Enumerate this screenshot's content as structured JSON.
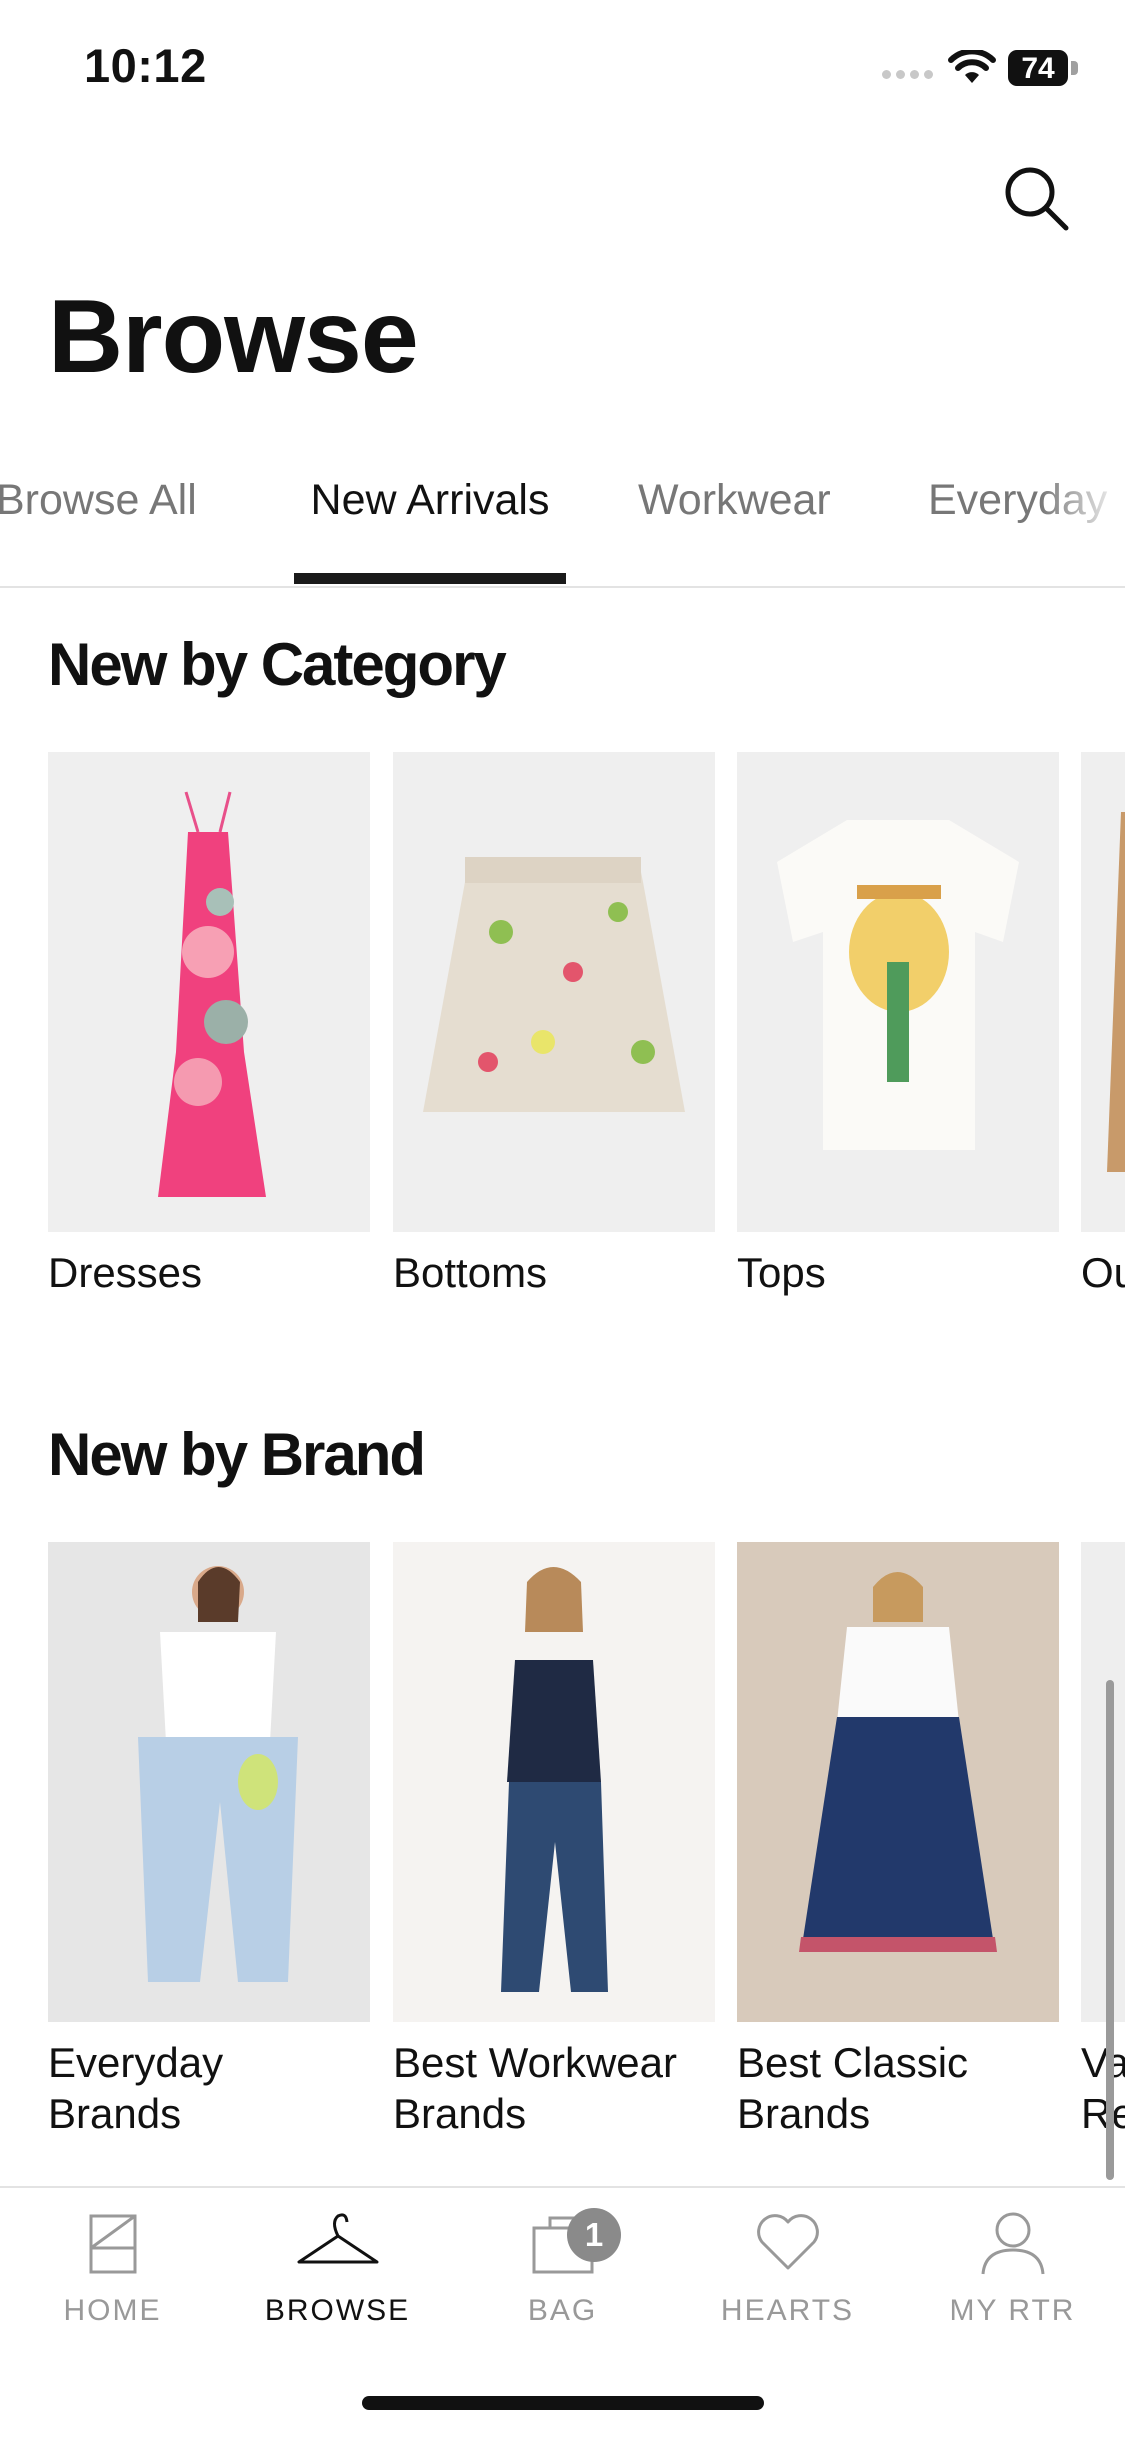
{
  "status_bar": {
    "time": "10:12",
    "battery": "74"
  },
  "header": {
    "title": "Browse"
  },
  "tabs": [
    {
      "label": "Browse All"
    },
    {
      "label": "New Arrivals"
    },
    {
      "label": "Workwear"
    },
    {
      "label": "Everyday"
    }
  ],
  "sections": [
    {
      "title": "New by Category",
      "items": [
        {
          "label": "Dresses"
        },
        {
          "label": "Bottoms"
        },
        {
          "label": "Tops"
        },
        {
          "label": "Ou"
        }
      ]
    },
    {
      "title": "New by Brand",
      "items": [
        {
          "line1": "Everyday",
          "line2": "Brands"
        },
        {
          "line1": "Best Workwear",
          "line2": "Brands"
        },
        {
          "line1": "Best Classic",
          "line2": "Brands"
        },
        {
          "line1": "Va",
          "line2": "Re"
        }
      ]
    }
  ],
  "bottom_nav": {
    "home": "HOME",
    "browse": "BROWSE",
    "bag": "BAG",
    "bag_count": "1",
    "hearts": "HEARTS",
    "my_rtr": "MY RTR"
  },
  "colors": {
    "active": "#111111",
    "inactive": "#777777",
    "badge": "#8a8a8a"
  }
}
